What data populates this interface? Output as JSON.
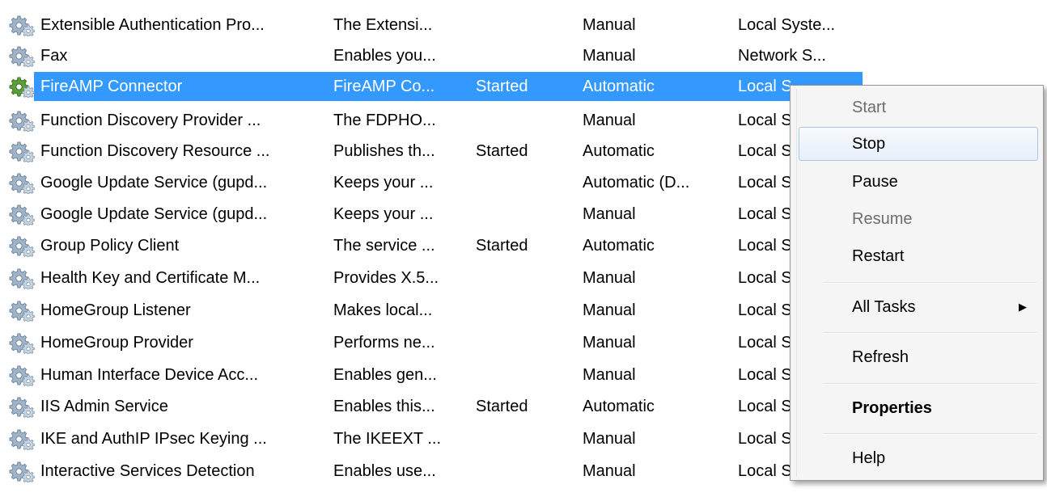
{
  "services": [
    {
      "name": "Extensible Authentication Pro...",
      "description": "The Extensi...",
      "status": "",
      "startup_type": "Manual",
      "log_on_as": "Local Syste..."
    },
    {
      "name": "Fax",
      "description": "Enables you...",
      "status": "",
      "startup_type": "Manual",
      "log_on_as": "Network S..."
    },
    {
      "name": "FireAMP Connector",
      "description": "FireAMP Co...",
      "status": "Started",
      "startup_type": "Automatic",
      "log_on_as": "Local S...",
      "selected": true
    },
    {
      "name": "Function Discovery Provider ...",
      "description": "The FDPHO...",
      "status": "",
      "startup_type": "Manual",
      "log_on_as": "Local S"
    },
    {
      "name": "Function Discovery Resource ...",
      "description": "Publishes th...",
      "status": "Started",
      "startup_type": "Automatic",
      "log_on_as": "Local S"
    },
    {
      "name": "Google Update Service (gupd...",
      "description": "Keeps your ...",
      "status": "",
      "startup_type": "Automatic (D...",
      "log_on_as": "Local S"
    },
    {
      "name": "Google Update Service (gupd...",
      "description": "Keeps your ...",
      "status": "",
      "startup_type": "Manual",
      "log_on_as": "Local S"
    },
    {
      "name": "Group Policy Client",
      "description": "The service ...",
      "status": "Started",
      "startup_type": "Automatic",
      "log_on_as": "Local S"
    },
    {
      "name": "Health Key and Certificate M...",
      "description": "Provides X.5...",
      "status": "",
      "startup_type": "Manual",
      "log_on_as": "Local S"
    },
    {
      "name": "HomeGroup Listener",
      "description": "Makes local...",
      "status": "",
      "startup_type": "Manual",
      "log_on_as": "Local S"
    },
    {
      "name": "HomeGroup Provider",
      "description": "Performs ne...",
      "status": "",
      "startup_type": "Manual",
      "log_on_as": "Local S"
    },
    {
      "name": "Human Interface Device Acc...",
      "description": "Enables gen...",
      "status": "",
      "startup_type": "Manual",
      "log_on_as": "Local S"
    },
    {
      "name": "IIS Admin Service",
      "description": "Enables this...",
      "status": "Started",
      "startup_type": "Automatic",
      "log_on_as": "Local S"
    },
    {
      "name": "IKE and AuthIP IPsec Keying ...",
      "description": "The IKEEXT ...",
      "status": "",
      "startup_type": "Manual",
      "log_on_as": "Local S"
    },
    {
      "name": "Interactive Services Detection",
      "description": "Enables use...",
      "status": "",
      "startup_type": "Manual",
      "log_on_as": "Local S"
    }
  ],
  "context_menu": {
    "items": [
      {
        "label": "Start",
        "enabled": false
      },
      {
        "label": "Stop",
        "enabled": true,
        "highlighted": true
      },
      {
        "label": "Pause",
        "enabled": true
      },
      {
        "label": "Resume",
        "enabled": false
      },
      {
        "label": "Restart",
        "enabled": true
      },
      {
        "label": "All Tasks",
        "enabled": true,
        "submenu": true,
        "arrow": "▶"
      },
      {
        "label": "Refresh",
        "enabled": true
      },
      {
        "label": "Properties",
        "enabled": true,
        "bold": true
      },
      {
        "label": "Help",
        "enabled": true
      }
    ]
  },
  "icons": {
    "service": "gear-icon",
    "submenu": "submenu-arrow-icon"
  },
  "colors": {
    "selection": "#3399ff",
    "menu_background": "#f5f5f5",
    "menu_hover_border": "#a8c8ea",
    "disabled_text": "#6d6d6d"
  }
}
